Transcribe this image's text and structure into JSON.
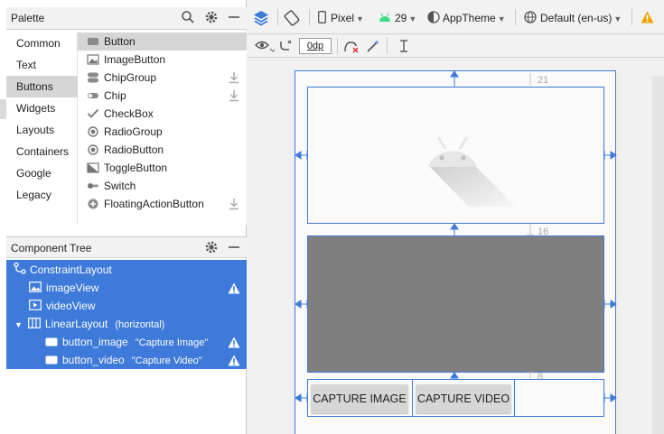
{
  "palette": {
    "title": "Palette",
    "categories": [
      "Common",
      "Text",
      "Buttons",
      "Widgets",
      "Layouts",
      "Containers",
      "Google",
      "Legacy"
    ],
    "selected_category": "Buttons",
    "widgets": [
      {
        "label": "Button",
        "icon": "button-icon"
      },
      {
        "label": "ImageButton",
        "icon": "image-button-icon"
      },
      {
        "label": "ChipGroup",
        "icon": "chip-group-icon",
        "download": true
      },
      {
        "label": "Chip",
        "icon": "chip-icon",
        "download": true
      },
      {
        "label": "CheckBox",
        "icon": "checkbox-icon"
      },
      {
        "label": "RadioGroup",
        "icon": "radio-group-icon"
      },
      {
        "label": "RadioButton",
        "icon": "radio-button-icon"
      },
      {
        "label": "ToggleButton",
        "icon": "toggle-button-icon"
      },
      {
        "label": "Switch",
        "icon": "switch-icon"
      },
      {
        "label": "FloatingActionButton",
        "icon": "fab-icon",
        "download": true
      }
    ]
  },
  "component_tree": {
    "title": "Component Tree",
    "nodes": [
      {
        "label": "ConstraintLayout",
        "icon": "constraint-layout-icon"
      },
      {
        "label": "imageView",
        "icon": "image-view-icon",
        "warning": true
      },
      {
        "label": "videoView",
        "icon": "video-view-icon"
      },
      {
        "label": "LinearLayout",
        "extra": "(horizontal)",
        "icon": "linear-layout-icon",
        "expanded": true
      },
      {
        "label": "button_image",
        "extra": "\"Capture Image\"",
        "icon": "button-icon",
        "warning": true
      },
      {
        "label": "button_video",
        "extra": "\"Capture Video\"",
        "icon": "button-icon",
        "warning": true
      }
    ]
  },
  "toolbar": {
    "device": "Pixel",
    "api_level": "29",
    "theme": "AppTheme",
    "locale": "Default (en-us)",
    "default_margin": "0dp"
  },
  "design": {
    "margins": [
      "21",
      "16",
      "8"
    ],
    "capture_image_label": "CAPTURE IMAGE",
    "capture_video_label": "CAPTURE VIDEO"
  },
  "colors": {
    "selection": "#3d7ad9",
    "blueprint": "#3d7ad9",
    "android_green": "#3ddc84",
    "warning": "#f0a30a"
  }
}
